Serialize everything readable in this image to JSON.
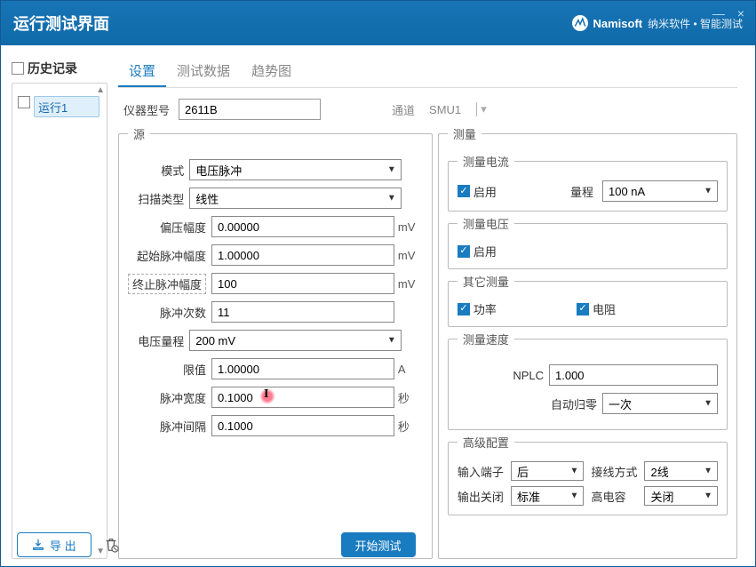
{
  "titlebar": {
    "title": "运行测试界面",
    "brand_name": "Namisoft",
    "brand_sub": "纳米软件 • 智能测试",
    "minimize": "—",
    "close": "×"
  },
  "history": {
    "header": "历史记录",
    "items": [
      {
        "label": "运行1",
        "selected": true
      }
    ]
  },
  "tabs": {
    "setting": "设置",
    "data": "测试数据",
    "trend": "趋势图",
    "active": "设置"
  },
  "top": {
    "model_label": "仪器型号",
    "model_value": "2611B",
    "channel_label": "通道",
    "channel_value": "SMU1"
  },
  "source": {
    "legend": "源",
    "mode_label": "模式",
    "mode_value": "电压脉冲",
    "scan_type_label": "扫描类型",
    "scan_type_value": "线性",
    "bias_label": "偏压幅度",
    "bias_value": "0.00000",
    "bias_unit": "mV",
    "start_label": "起始脉冲幅度",
    "start_value": "1.00000",
    "start_unit": "mV",
    "stop_label": "终止脉冲幅度",
    "stop_value": "100",
    "stop_unit": "mV",
    "count_label": "脉冲次数",
    "count_value": "11",
    "vrange_label": "电压量程",
    "vrange_value": "200 mV",
    "limit_label": "限值",
    "limit_value": "1.00000",
    "limit_unit": "A",
    "pwidth_label": "脉冲宽度",
    "pwidth_value": "0.1000",
    "pwidth_unit": "秒",
    "pgap_label": "脉冲间隔",
    "pgap_value": "0.1000",
    "pgap_unit": "秒"
  },
  "measure": {
    "legend": "测量",
    "current": {
      "legend": "测量电流",
      "enable": "启用",
      "range_label": "量程",
      "range_value": "100 nA"
    },
    "voltage": {
      "legend": "测量电压",
      "enable": "启用"
    },
    "other": {
      "legend": "其它测量",
      "power": "功率",
      "resistance": "电阻"
    },
    "speed": {
      "legend": "测量速度",
      "nplc_label": "NPLC",
      "nplc_value": "1.000",
      "autozero_label": "自动归零",
      "autozero_value": "一次"
    },
    "adv": {
      "legend": "高级配置",
      "in_term_label": "输入端子",
      "in_term_value": "后",
      "wiring_label": "接线方式",
      "wiring_value": "2线",
      "out_off_label": "输出关闭",
      "out_off_value": "标准",
      "hicap_label": "高电容",
      "hicap_value": "关闭"
    }
  },
  "bottom": {
    "export": "导 出",
    "start": "开始测试"
  },
  "icons": {
    "download": "download-icon",
    "trash": "trash-icon",
    "logo": "namisoft-logo"
  }
}
